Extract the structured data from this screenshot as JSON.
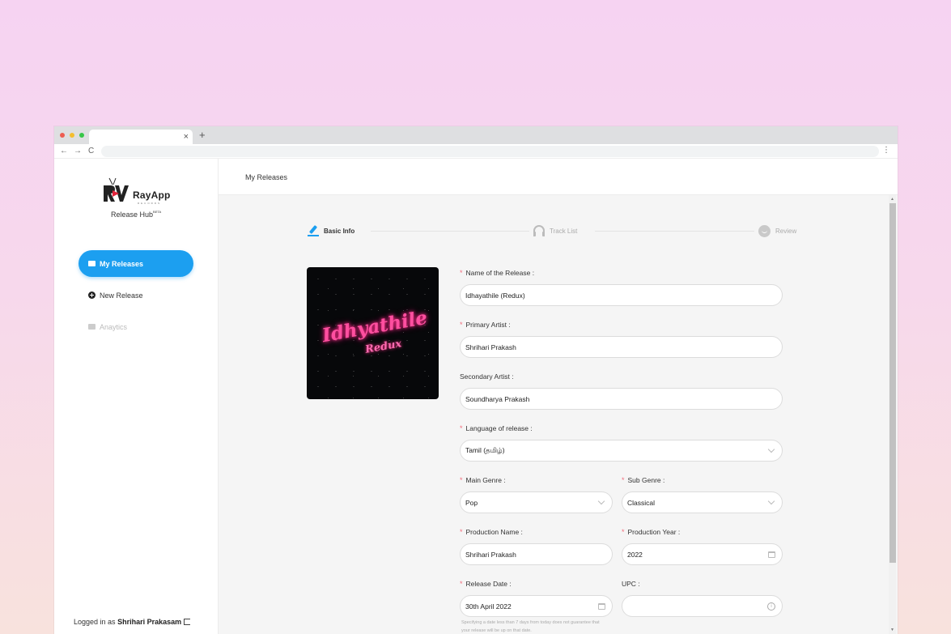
{
  "browser": {
    "tab_close": "×",
    "new_tab": "+",
    "back": "←",
    "forward": "→",
    "reload": "C",
    "menu": "⋮"
  },
  "sidebar": {
    "logo_text": "RayApp",
    "logo_sub": "RECORDS",
    "app_name": "Release Hub",
    "app_badge": "BETA",
    "items": [
      {
        "label": "My Releases",
        "icon": "folder-icon",
        "active": true
      },
      {
        "label": "New Release",
        "icon": "plus-circle-icon",
        "active": false
      },
      {
        "label": "Anaytics",
        "icon": "chart-icon",
        "disabled": true
      }
    ],
    "logged_prefix": "Logged in as",
    "user_name": "Shrihari Prakasam"
  },
  "header": {
    "title": "My Releases"
  },
  "steps": [
    {
      "label": "Basic Info",
      "icon": "pencil-icon",
      "active": true
    },
    {
      "label": "Track List",
      "icon": "headphones-icon",
      "active": false
    },
    {
      "label": "Review",
      "icon": "smiley-icon",
      "active": false
    }
  ],
  "cover": {
    "title": "Idhyathile",
    "subtitle": "Redux"
  },
  "form": {
    "release_name": {
      "label": "Name of the Release :",
      "value": "Idhayathile (Redux)",
      "required": true
    },
    "primary_artist": {
      "label": "Primary Artist :",
      "value": "Shrihari Prakash",
      "required": true
    },
    "secondary_artist": {
      "label": "Secondary Artist :",
      "value": "Soundharya Prakash",
      "required": false
    },
    "language": {
      "label": "Language of release :",
      "value": "Tamil (தமிழ்)",
      "required": true
    },
    "main_genre": {
      "label": "Main Genre :",
      "value": "Pop",
      "required": true
    },
    "sub_genre": {
      "label": "Sub Genre :",
      "value": "Classical",
      "required": true
    },
    "production_name": {
      "label": "Production Name :",
      "value": "Shrihari Prakash",
      "required": true
    },
    "production_year": {
      "label": "Production Year :",
      "value": "2022",
      "required": true
    },
    "release_date": {
      "label": "Release Date :",
      "value": "30th April 2022",
      "required": true
    },
    "upc": {
      "label": "UPC :",
      "value": "",
      "required": false
    },
    "release_hint": "Specifying a date less than 7 days from today does not guarantee that your release will be up on that date."
  },
  "colors": {
    "accent": "#1c9ff0",
    "required": "#f26d7d",
    "cover_text": "#ff4fa0"
  }
}
